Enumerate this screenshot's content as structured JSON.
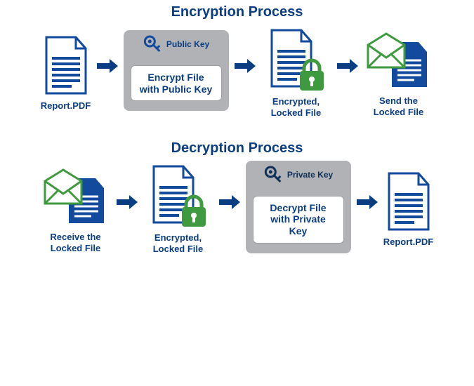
{
  "encryption": {
    "title": "Encryption Process",
    "plain_doc_caption": "Report.PDF",
    "key_label": "Public Key",
    "process_label": "Encrypt File with Public Key",
    "encrypted_doc_caption": "Encrypted, Locked File",
    "send_caption": "Send the Locked File"
  },
  "decryption": {
    "title": "Decryption Process",
    "receive_caption": "Receive the Locked File",
    "encrypted_doc_caption": "Encrypted, Locked File",
    "key_label": "Private Key",
    "process_label": "Decrypt File with Private Key",
    "plain_doc_caption": "Report.PDF"
  },
  "colors": {
    "primary_blue": "#124a9e",
    "dark_navy": "#0e2f57",
    "green": "#3f9a3f",
    "gray": "#b0b2b5"
  }
}
